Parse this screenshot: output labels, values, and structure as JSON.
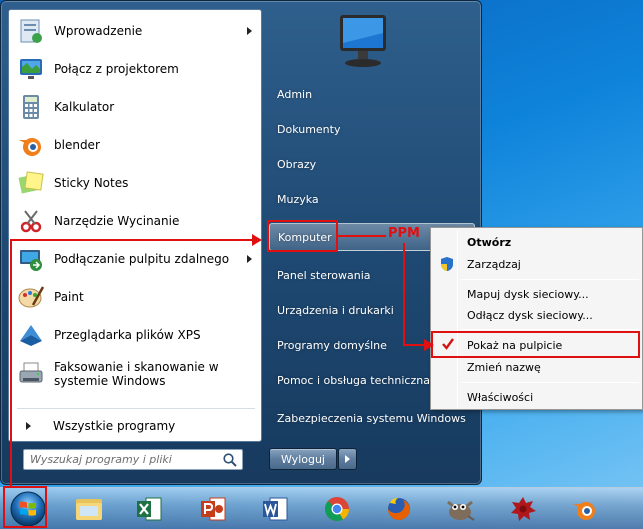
{
  "left_pane": {
    "programs": [
      {
        "label": "Wprowadzenie",
        "icon": "getting-started-icon",
        "submenu": true
      },
      {
        "label": "Połącz z projektorem",
        "icon": "projector-icon",
        "submenu": false
      },
      {
        "label": "Kalkulator",
        "icon": "calculator-icon",
        "submenu": false
      },
      {
        "label": "blender",
        "icon": "blender-icon",
        "submenu": false
      },
      {
        "label": "Sticky Notes",
        "icon": "sticky-notes-icon",
        "submenu": false
      },
      {
        "label": "Narzędzie Wycinanie",
        "icon": "snipping-tool-icon",
        "submenu": false
      },
      {
        "label": "Podłączanie pulpitu zdalnego",
        "icon": "remote-desktop-icon",
        "submenu": true
      },
      {
        "label": "Paint",
        "icon": "paint-icon",
        "submenu": false
      },
      {
        "label": "Przeglądarka plików XPS",
        "icon": "xps-viewer-icon",
        "submenu": false
      },
      {
        "label": "Faksowanie i skanowanie w systemie Windows",
        "icon": "fax-scan-icon",
        "submenu": false
      }
    ],
    "all_programs": "Wszystkie programy"
  },
  "search": {
    "placeholder": "Wyszukaj programy i pliki"
  },
  "right_pane": {
    "items": [
      {
        "label": "Admin"
      },
      {
        "label": "Dokumenty"
      },
      {
        "label": "Obrazy"
      },
      {
        "label": "Muzyka"
      },
      {
        "label": "Komputer"
      },
      {
        "label": "Panel sterowania"
      },
      {
        "label": "Urządzenia i drukarki"
      },
      {
        "label": "Programy domyślne"
      },
      {
        "label": "Pomoc i obsługa techniczna"
      },
      {
        "label": "Zabezpieczenia systemu Windows"
      }
    ],
    "logoff": "Wyloguj"
  },
  "context_menu": {
    "items": [
      {
        "label": "Otwórz",
        "bold": true
      },
      {
        "label": "Zarządzaj",
        "icon": "uac-shield-icon"
      },
      {
        "label": "Mapuj dysk sieciowy..."
      },
      {
        "label": "Odłącz dysk sieciowy..."
      },
      {
        "label": "Pokaż na pulpicie",
        "checked": true
      },
      {
        "label": "Zmień nazwę"
      },
      {
        "label": "Właściwości"
      }
    ]
  },
  "annotation": {
    "label": "PPM",
    "color": "#e01010"
  },
  "taskbar": {
    "apps": [
      "explorer-icon",
      "excel-icon",
      "powerpoint-icon",
      "word-icon",
      "chrome-icon",
      "firefox-icon",
      "gimp-icon",
      "gear-app-icon",
      "blender-icon"
    ]
  }
}
